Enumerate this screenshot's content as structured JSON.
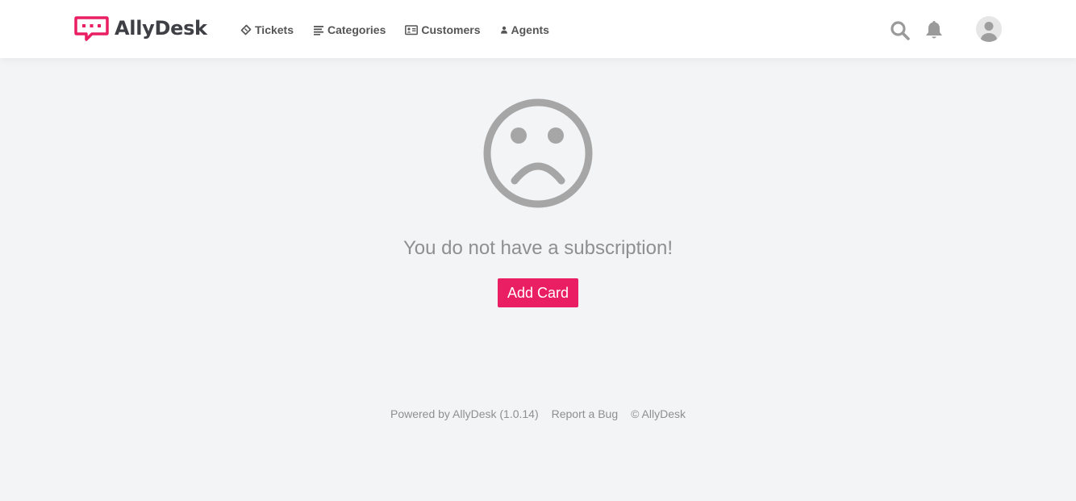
{
  "brand": {
    "name": "AllyDesk",
    "color": "#e91e63"
  },
  "nav": {
    "items": [
      {
        "label": "Tickets",
        "icon": "ticket-icon"
      },
      {
        "label": "Categories",
        "icon": "list-icon"
      },
      {
        "label": "Customers",
        "icon": "id-card-icon"
      },
      {
        "label": "Agents",
        "icon": "user-icon"
      }
    ]
  },
  "header_actions": {
    "search_icon": "search-icon",
    "notifications_icon": "bell-icon",
    "profile_icon": "avatar"
  },
  "empty_state": {
    "icon": "sad-face-icon",
    "message": "You do not have a subscription!",
    "button_label": "Add Card",
    "button_color": "#e91e63"
  },
  "footer": {
    "powered_by": "Powered by AllyDesk (1.0.14)",
    "report_bug": "Report a Bug",
    "copyright": "© AllyDesk"
  }
}
